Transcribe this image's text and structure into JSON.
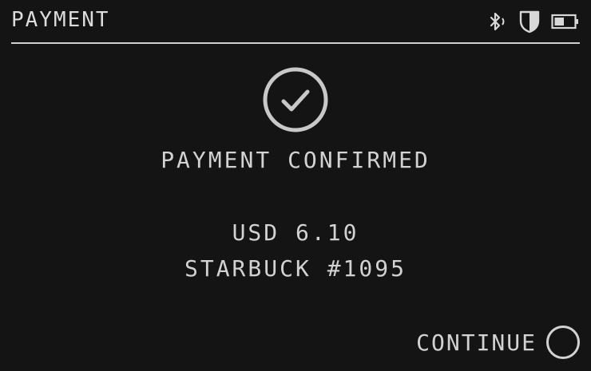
{
  "header": {
    "title": "PAYMENT",
    "status_icons": [
      "bluetooth-icon",
      "shield-icon",
      "battery-icon"
    ],
    "battery_level": 0.5
  },
  "confirmation": {
    "icon": "check-circle-icon",
    "status_text": "PAYMENT CONFIRMED"
  },
  "transaction": {
    "amount": "USD 6.10",
    "merchant": "STARBUCK #1095"
  },
  "actions": {
    "continue_label": "CONTINUE",
    "continue_icon": "circle-button-icon"
  },
  "colors": {
    "background": "#141414",
    "foreground": "#d2d2d2"
  }
}
